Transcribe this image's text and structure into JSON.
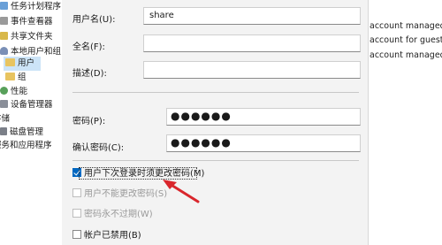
{
  "tree": {
    "items": [
      {
        "label": "任务计划程序",
        "icon": "task-scheduler-icon"
      },
      {
        "label": "事件查看器",
        "icon": "event-viewer-icon"
      },
      {
        "label": "共享文件夹",
        "icon": "shared-folder-icon"
      },
      {
        "label": "本地用户和组",
        "icon": "local-users-icon"
      },
      {
        "label": "用户",
        "icon": "folder-icon"
      },
      {
        "label": "组",
        "icon": "folder-icon"
      },
      {
        "label": "性能",
        "icon": "performance-icon"
      },
      {
        "label": "设备管理器",
        "icon": "device-manager-icon"
      },
      {
        "label": "存储",
        "icon": ""
      },
      {
        "label": "磁盘管理",
        "icon": "disk-icon"
      },
      {
        "label": "服务和应用程序",
        "icon": ""
      }
    ]
  },
  "background_list": {
    "lines": [
      "account managed",
      "account for guest",
      "account managed"
    ]
  },
  "dialog": {
    "username_label": "用户名(U):",
    "username_value": "share",
    "fullname_label": "全名(F):",
    "fullname_value": "",
    "description_label": "描述(D):",
    "description_value": "",
    "password_label": "密码(P):",
    "password_value": "●●●●●●",
    "confirm_label": "确认密码(C):",
    "confirm_value": "●●●●●●",
    "checkboxes": [
      {
        "label": "用户下次登录时须更改密码(M)",
        "checked": true,
        "enabled": true
      },
      {
        "label": "用户不能更改密码(S)",
        "checked": false,
        "enabled": false
      },
      {
        "label": "密码永不过期(W)",
        "checked": false,
        "enabled": false
      },
      {
        "label": "帐户已禁用(B)",
        "checked": false,
        "enabled": true
      }
    ]
  },
  "colors": {
    "accent": "#0067c0",
    "arrow": "#d9262c",
    "selection": "#cce4f7"
  }
}
